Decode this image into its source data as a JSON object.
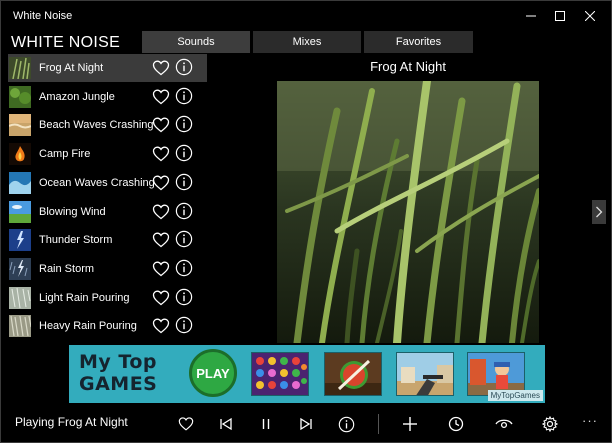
{
  "window": {
    "title": "White Noise"
  },
  "header": {
    "brand": "WHITE NOISE",
    "tabs": [
      {
        "label": "Sounds",
        "active": true
      },
      {
        "label": "Mixes",
        "active": false
      },
      {
        "label": "Favorites",
        "active": false
      }
    ]
  },
  "sounds": [
    {
      "name": "Frog At Night",
      "selected": true
    },
    {
      "name": "Amazon Jungle",
      "selected": false
    },
    {
      "name": "Beach Waves Crashing",
      "selected": false
    },
    {
      "name": "Camp Fire",
      "selected": false
    },
    {
      "name": "Ocean Waves Crashing",
      "selected": false
    },
    {
      "name": "Blowing Wind",
      "selected": false
    },
    {
      "name": "Thunder Storm",
      "selected": false
    },
    {
      "name": "Rain Storm",
      "selected": false
    },
    {
      "name": "Light Rain Pouring",
      "selected": false
    },
    {
      "name": "Heavy Rain Pouring",
      "selected": false
    }
  ],
  "main": {
    "current_title": "Frog At Night"
  },
  "ad": {
    "logo_line1": "My Top",
    "logo_line2": "GAMES",
    "play_label": "PLAY",
    "credit": "MyTopGames"
  },
  "player": {
    "status": "Playing Frog At Night"
  },
  "colors": {
    "background": "#000000",
    "selected_row": "#3b3b3b",
    "tab": "#2b2b2b",
    "ad_background": "#33acbd",
    "ad_play": "#2ea843"
  },
  "icons": {
    "minimize": "minimize-icon",
    "maximize": "maximize-icon",
    "close": "close-icon",
    "favorite": "heart-icon",
    "info": "info-icon",
    "previous": "skip-previous-icon",
    "pause": "pause-icon",
    "next": "skip-next-icon",
    "add": "plus-icon",
    "timer": "clock-icon",
    "view": "eye-icon",
    "settings": "gear-icon",
    "more": "more-icon"
  }
}
